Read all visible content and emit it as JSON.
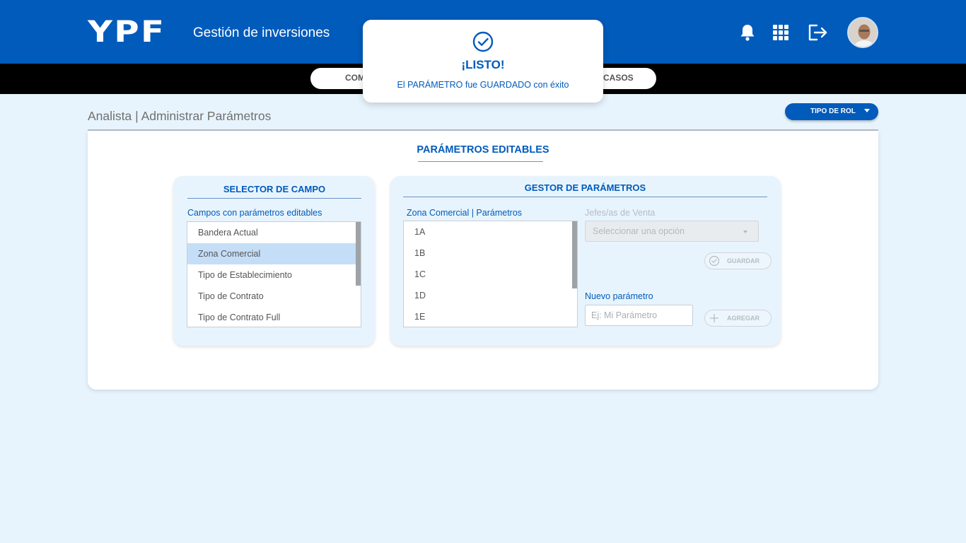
{
  "header": {
    "logo_text": "YPF",
    "app_title": "Gestión de inversiones",
    "icons": [
      "bell-icon",
      "apps-grid-icon",
      "logout-icon"
    ],
    "brand_color": "#005bbb"
  },
  "nav": {
    "items": [
      {
        "label": "COM"
      },
      {
        "label": "CASOS"
      }
    ]
  },
  "toast": {
    "icon": "check-circle-icon",
    "title": "¡LISTO!",
    "message": "El PARÁMETRO fue GUARDADO con éxito"
  },
  "page": {
    "title": "Analista | Administrar Parámetros",
    "role_button": "TIPO DE ROL"
  },
  "card": {
    "heading": "PARÁMETROS EDITABLES"
  },
  "field_selector": {
    "title": "SELECTOR DE CAMPO",
    "label": "Campos con parámetros editables",
    "items": [
      "Bandera Actual",
      "Zona Comercial",
      "Tipo de Establecimiento",
      "Tipo de Contrato",
      "Tipo de Contrato Full"
    ],
    "selected": "Zona Comercial"
  },
  "param_manager": {
    "title": "GESTOR DE PARÁMETROS",
    "list_label": "Zona Comercial | Parámetros",
    "items": [
      "1A",
      "1B",
      "1C",
      "1D",
      "1E"
    ],
    "jefes_label": "Jefes/as de Venta",
    "select_value": "Seleccionar una opción",
    "save_button": "GUARDAR",
    "new_label": "Nuevo parámetro",
    "new_placeholder": "Ej: Mi Parámetro",
    "add_button": "AGREGAR"
  }
}
